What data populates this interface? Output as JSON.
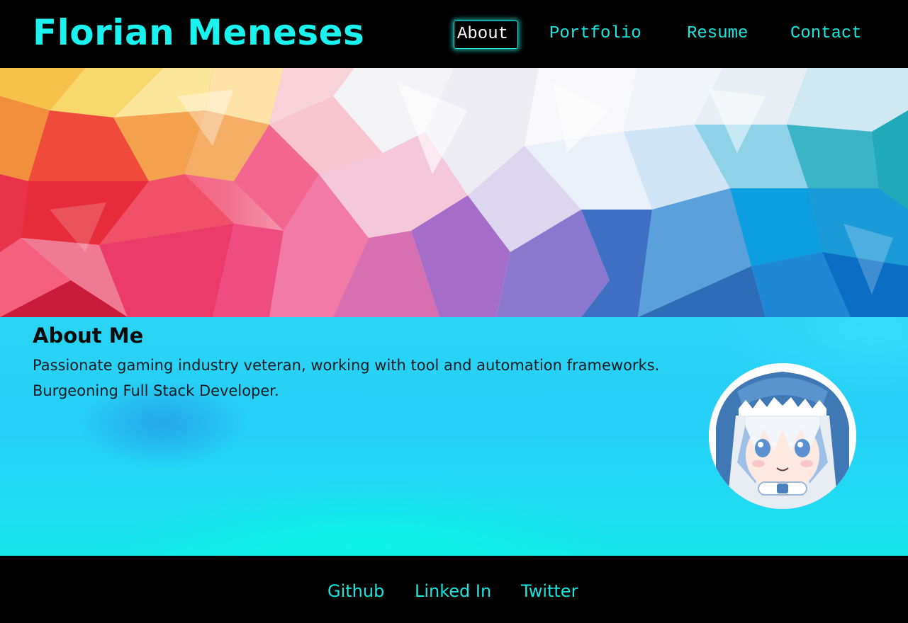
{
  "header": {
    "site_title": "Florian Meneses",
    "nav": {
      "about": "About",
      "portfolio": "Portfolio",
      "resume": "Resume",
      "contact": "Contact"
    },
    "active_nav": "About"
  },
  "about": {
    "heading": "About Me",
    "line_1": "Passionate gaming industry veteran, working with tool and automation frameworks.",
    "line_2": "Burgeoning Full Stack Developer."
  },
  "footer": {
    "links": {
      "github": "Github",
      "linkedin": "Linked In",
      "twitter": "Twitter"
    }
  },
  "colors": {
    "accent": "#19f2ee",
    "header_bg": "#000000",
    "about_bg": "#25cff6",
    "body_text": "#121a22"
  }
}
